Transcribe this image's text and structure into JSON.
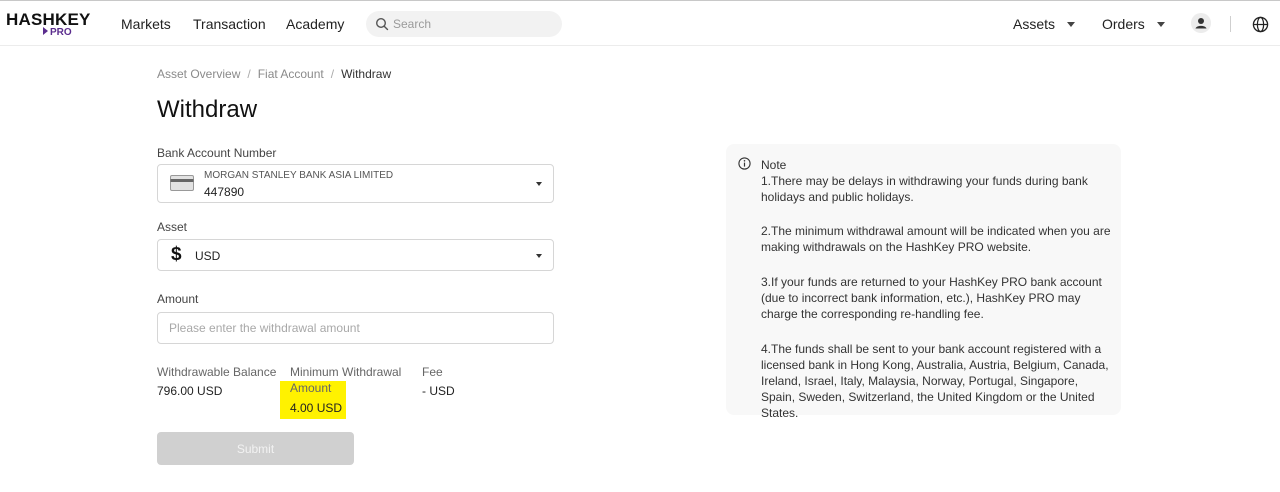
{
  "header": {
    "logo_main": "HASHKEY",
    "logo_sub": "PRO",
    "nav": [
      "Markets",
      "Transaction",
      "Academy"
    ],
    "search_placeholder": "Search",
    "assets_label": "Assets",
    "orders_label": "Orders",
    "icons": [
      "search-icon",
      "chevron-down-icon",
      "user-icon",
      "globe-icon"
    ]
  },
  "breadcrumb": [
    "Asset Overview",
    "Fiat Account",
    "Withdraw"
  ],
  "page_title": "Withdraw",
  "form": {
    "bank_account_label": "Bank Account Number",
    "bank_name": "MORGAN STANLEY BANK ASIA LIMITED",
    "bank_account_number": "447890",
    "asset_label": "Asset",
    "asset_value": "USD",
    "amount_label": "Amount",
    "amount_placeholder": "Please enter the withdrawal amount",
    "amount_value": "",
    "withdrawable_label": "Withdrawable Balance",
    "withdrawable_value": "796.00 USD",
    "min_withdrawal_label_line1": "Minimum Withdrawal",
    "min_withdrawal_label_line2": "Amount",
    "min_withdrawal_value": "4.00 USD",
    "fee_label": "Fee",
    "fee_value": "- USD",
    "submit_label": "Submit"
  },
  "note": {
    "title": "Note",
    "p1": "1.There may be delays in withdrawing your funds during bank holidays and public holidays.",
    "p2": "2.The minimum withdrawal amount will be indicated when you are making withdrawals on the HashKey PRO website.",
    "p3": "3.If your funds are returned to your HashKey PRO bank account (due to incorrect bank information, etc.), HashKey PRO may charge the corresponding re-handling fee.",
    "p4": "4.The funds shall be sent to your bank account registered with a licensed bank in Hong Kong, Australia, Austria, Belgium, Canada, Ireland, Israel, Italy, Malaysia, Norway, Portugal, Singapore, Spain, Sweden, Switzerland, the United Kingdom or the United States."
  },
  "colors": {
    "brand_purple": "#5b2d8e",
    "highlight_yellow": "#fff200",
    "submit_disabled": "#d0d0d0",
    "note_bg": "#f8f8f8"
  }
}
